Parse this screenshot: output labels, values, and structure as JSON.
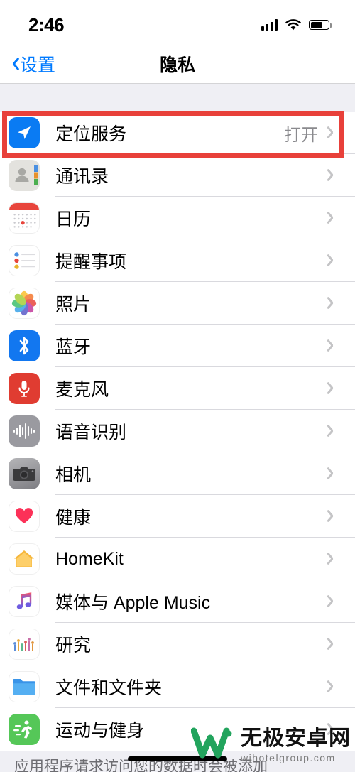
{
  "status_bar": {
    "time": "2:46",
    "signal_icon": "cellular-signal-icon",
    "wifi_icon": "wifi-icon",
    "battery_icon": "battery-icon",
    "battery_level_pct": 62
  },
  "nav": {
    "back_label": "设置",
    "back_icon": "chevron-left-icon",
    "title": "隐私"
  },
  "highlight": {
    "color": "#E8403A",
    "target": "定位服务"
  },
  "list": [
    {
      "label": "定位服务",
      "value": "打开",
      "icon": "location-arrow-icon"
    },
    {
      "label": "通讯录",
      "value": "",
      "icon": "contacts-icon"
    },
    {
      "label": "日历",
      "value": "",
      "icon": "calendar-icon"
    },
    {
      "label": "提醒事项",
      "value": "",
      "icon": "reminders-icon"
    },
    {
      "label": "照片",
      "value": "",
      "icon": "photos-icon"
    },
    {
      "label": "蓝牙",
      "value": "",
      "icon": "bluetooth-icon"
    },
    {
      "label": "麦克风",
      "value": "",
      "icon": "microphone-icon"
    },
    {
      "label": "语音识别",
      "value": "",
      "icon": "speech-recognition-icon"
    },
    {
      "label": "相机",
      "value": "",
      "icon": "camera-icon"
    },
    {
      "label": "健康",
      "value": "",
      "icon": "health-heart-icon"
    },
    {
      "label": "HomeKit",
      "value": "",
      "icon": "homekit-house-icon"
    },
    {
      "label": "媒体与 Apple Music",
      "value": "",
      "icon": "music-note-icon"
    },
    {
      "label": "研究",
      "value": "",
      "icon": "research-chart-icon"
    },
    {
      "label": "文件和文件夹",
      "value": "",
      "icon": "folder-icon"
    },
    {
      "label": "运动与健身",
      "value": "",
      "icon": "running-person-icon"
    }
  ],
  "footer": {
    "note": "应用程序请求访问您的数据时会被添加"
  },
  "watermark": {
    "title": "无极安卓网",
    "subtitle": "wjhotelgroup.com",
    "logo": "w-logo-icon",
    "color": "#22A45D"
  },
  "home_indicator": "home-indicator"
}
